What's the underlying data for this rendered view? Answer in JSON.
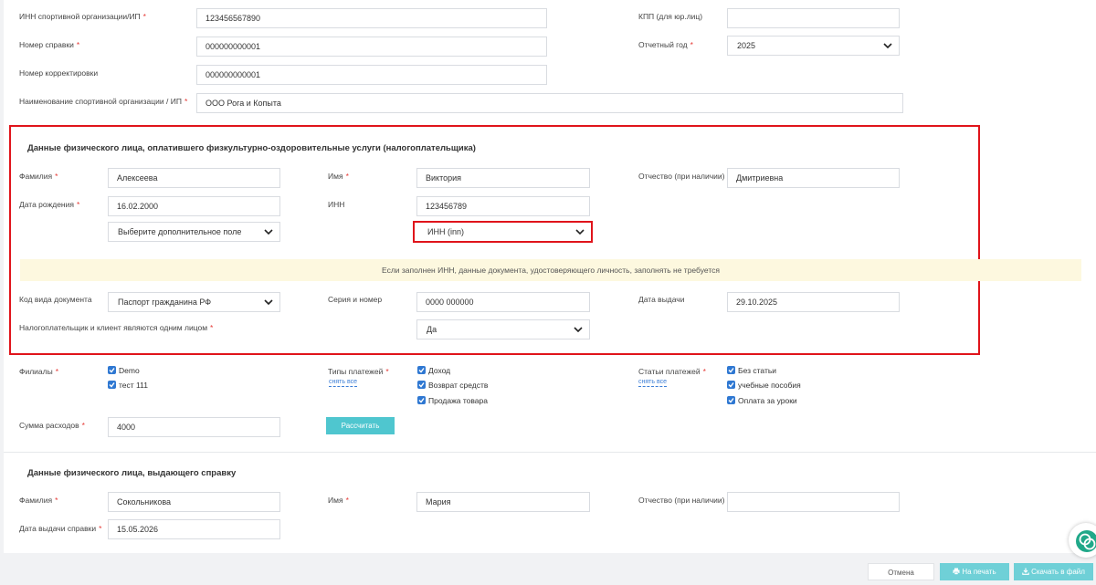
{
  "top": {
    "inn_label": "ИНН спортивной организации/ИП",
    "inn_value": "123456567890",
    "kpp_label": "КПП (для юр.лиц)",
    "kpp_value": "",
    "cert_no_label": "Номер справки",
    "cert_no_value": "000000000001",
    "year_label": "Отчетный год",
    "year_value": "2025",
    "correction_label": "Номер корректировки",
    "correction_value": "000000000001",
    "org_name_label": "Наименование спортивной организации / ИП",
    "org_name_value": "ООО Рога и Копыта"
  },
  "payer": {
    "title": "Данные физического лица, оплатившего физкультурно-оздоровительные услуги (налогоплательщика)",
    "last_name_label": "Фамилия",
    "last_name_value": "Алексеева",
    "first_name_label": "Имя",
    "first_name_value": "Виктория",
    "middle_name_label": "Отчество (при наличии)",
    "middle_name_value": "Дмитриевна",
    "birth_label": "Дата рождения",
    "birth_value": "16.02.2000",
    "inn_label": "ИНН",
    "inn_value": "123456789",
    "extra_field_select": "Выберите дополнительное поле",
    "inn_select": "ИНН (inn)",
    "notice": "Если заполнен ИНН, данные документа, удостоверяющего личность, заполнять не требуется",
    "doc_code_label": "Код вида документа",
    "doc_code_value": "Паспорт гражданина РФ",
    "series_label": "Серия и номер",
    "series_value": "0000 000000",
    "issue_date_label": "Дата выдачи",
    "issue_date_value": "29.10.2025",
    "same_person_label": "Налогоплательщик и клиент являются одним лицом",
    "same_person_value": "Да"
  },
  "filters": {
    "branches_label": "Филиалы",
    "branches": [
      "Demo",
      "тест 111"
    ],
    "payment_types_label": "Типы платежей",
    "payment_types_clear": "снять все",
    "payment_types": [
      "Доход",
      "Возврат средств",
      "Продажа товара"
    ],
    "payment_items_label": "Статьи платежей",
    "payment_items_clear": "снять все",
    "payment_items": [
      "Без статьи",
      "учебные пособия",
      "Оплата за уроки"
    ],
    "amount_label": "Сумма расходов",
    "amount_value": "4000",
    "calc_button": "Рассчитать"
  },
  "issuer": {
    "title": "Данные физического лица, выдающего справку",
    "last_name_label": "Фамилия",
    "last_name_value": "Сокольникова",
    "first_name_label": "Имя",
    "first_name_value": "Мария",
    "middle_name_label": "Отчество (при наличии)",
    "middle_name_value": "",
    "issue_date_label": "Дата выдачи справки",
    "issue_date_value": "15.05.2026"
  },
  "footer": {
    "cancel": "Отмена",
    "print": "На печать",
    "download": "Скачать в файл"
  },
  "colors": {
    "highlight": "#e0141b",
    "accent": "#4fc6cf",
    "checkbox": "#2f78d2",
    "required": "#e53935"
  },
  "required_mark": "*"
}
